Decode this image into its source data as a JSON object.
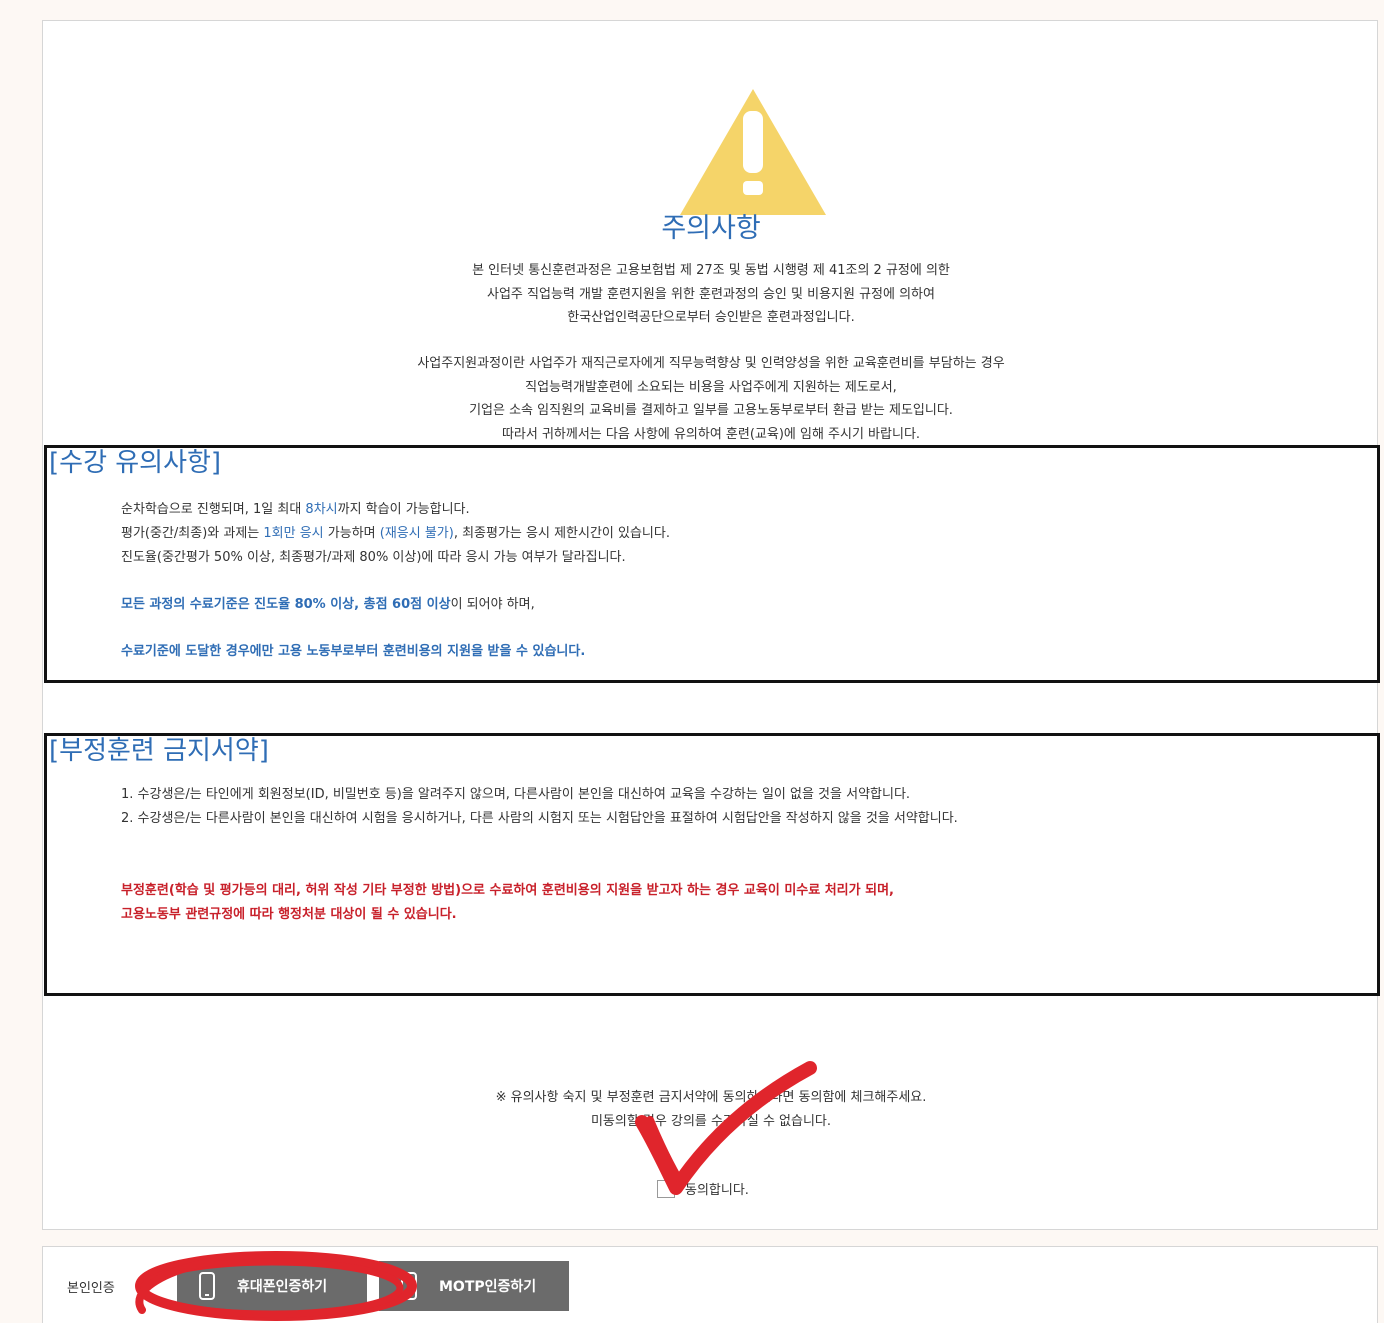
{
  "notice_title": "주의사항",
  "intro_para1": [
    "본 인터넷 통신훈련과정은 고용보험법 제 27조 및 동법 시행령 제 41조의 2 규정에 의한",
    "사업주 직업능력 개발 훈련지원을 위한 훈련과정의 승인 및 비용지원 규정에 의하여",
    "한국산업인력공단으로부터 승인받은 훈련과정입니다."
  ],
  "intro_para2": [
    "사업주지원과정이란 사업주가 재직근로자에게 직무능력향상 및 인력양성을 위한 교육훈련비를 부담하는 경우",
    "직업능력개발훈련에 소요되는 비용을 사업주에게 지원하는 제도로서,",
    "기업은 소속 임직원의 교육비를 결제하고 일부를 고용노동부로부터 환급 받는 제도입니다.",
    "따라서 귀하께서는 다음 사항에 유의하여 훈련(교육)에 임해 주시기 바랍니다."
  ],
  "course_notes": {
    "title": "[수강 유의사항]",
    "line1_a": "순차학습으로 진행되며, 1일 최대 ",
    "line1_b": "8차시",
    "line1_c": "까지 학습이 가능합니다.",
    "line2_a": "평가(중간/최종)와 과제는 ",
    "line2_b": "1회만 응시",
    "line2_c": " 가능하며 ",
    "line2_d": "(재응시 불가)",
    "line2_e": ", 최종평가는 응시 제한시간이 있습니다.",
    "line3": "진도율(중간평가 50% 이상, 최종평가/과제 80% 이상)에 따라 응시 가능 여부가 달라집니다.",
    "line4_a": "모든 과정의 수료기준은 진도율 80% 이상, 총점 60점 이상",
    "line4_b": "이 되어야 하며,",
    "line5_a": "수료기준에 도달한 경우에만 고용 노동부로부터 훈련비용의 지원을 받을 수 있습니다."
  },
  "pledge": {
    "title": "[부정훈련 금지서약]",
    "item1": "1. 수강생은/는 타인에게 회원정보(ID, 비밀번호 등)을 알려주지 않으며, 다른사람이 본인을 대신하여 교육을 수강하는 일이 없을 것을 서약합니다.",
    "item2": "2. 수강생은/는 다른사람이 본인을 대신하여 시험을 응시하거나, 다른 사람의 시험지 또는 시험답안을 표절하여 시험답안을 작성하지 않을 것을 서약합니다.",
    "warning1": "부정훈련(학습 및 평가등의 대리, 허위 작성 기타 부정한 방법)으로 수료하여 훈련비용의 지원을 받고자 하는 경우 교육이 미수료 처리가 되며,",
    "warning2": "고용노동부 관련규정에 따라 행정처분 대상이 될 수 있습니다."
  },
  "consent_notice": [
    "※ 유의사항 숙지 및 부정훈련 금지서약에 동의하셨다면 동의함에 체크해주세요.",
    "미동의할 경우 강의를 수강하실 수 없습니다."
  ],
  "agree_label": "동의합니다.",
  "auth": {
    "label": "본인인증",
    "phone_button": "휴대폰인증하기",
    "motp_button": "MOTP인증하기"
  },
  "colors": {
    "accent_blue": "#2f6db5",
    "warning_red": "#c8202a",
    "warning_yellow": "#f5d469",
    "annotation_red": "#e0252c",
    "button_gray": "#6b6b6b"
  }
}
